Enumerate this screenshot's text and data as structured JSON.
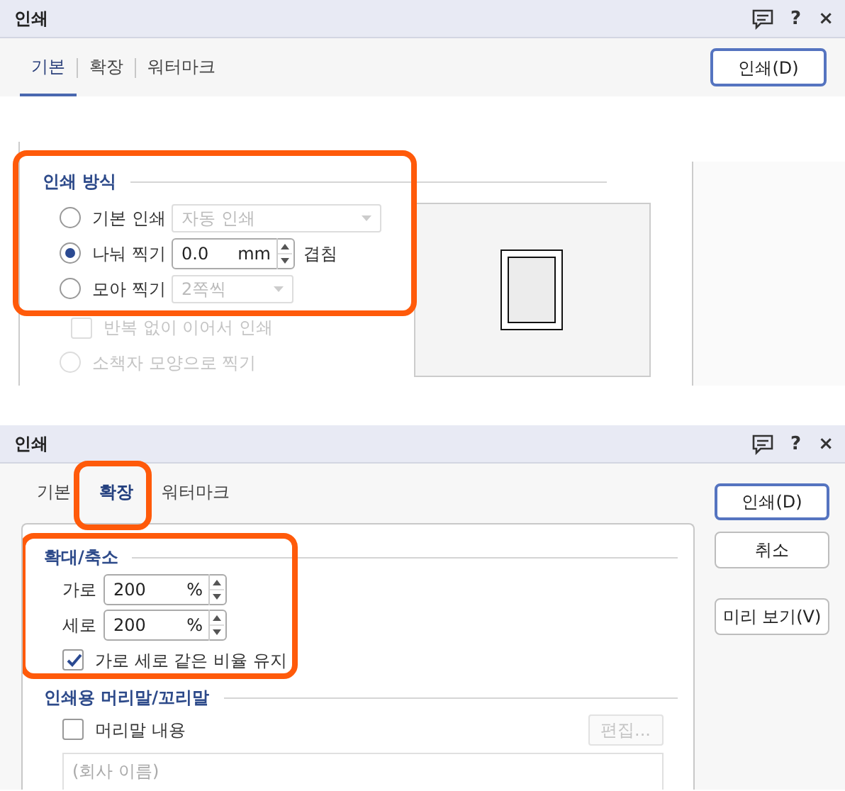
{
  "dialogs": [
    {
      "kind": "basic",
      "title": "인쇄",
      "title_buttons": [
        "?",
        "×"
      ],
      "tabs": [
        {
          "label": "기본",
          "selected": true,
          "highlighted": false
        },
        {
          "label": "확장",
          "selected": false,
          "highlighted": false
        },
        {
          "label": "워터마크",
          "selected": false,
          "highlighted": false
        }
      ],
      "button_groups": [
        [
          {
            "label": "인쇄(D)",
            "default": true
          }
        ]
      ],
      "section": {
        "title": "인쇄 방식",
        "highlighted": true,
        "options": [
          {
            "kind": "radio",
            "label": "기본 인쇄",
            "selected": false,
            "disabled": false,
            "control": {
              "kind": "dropdown",
              "value": "자동 인쇄",
              "disabled": true
            }
          },
          {
            "kind": "radio",
            "label": "나눠 찍기",
            "selected": true,
            "disabled": false,
            "control": {
              "kind": "spin",
              "value": "0.0",
              "unit": "mm",
              "suffix": "겹침"
            }
          },
          {
            "kind": "radio",
            "label": "모아 찍기",
            "selected": false,
            "disabled": false,
            "control": {
              "kind": "dropdown",
              "value": "2쪽씩",
              "disabled": true
            }
          },
          {
            "kind": "checkbox",
            "label": "반복 없이 이어서 인쇄",
            "checked": false,
            "disabled": true
          },
          {
            "kind": "radio",
            "label": "소책자 모양으로 찍기",
            "selected": false,
            "disabled": true
          }
        ]
      }
    },
    {
      "kind": "extended",
      "title": "인쇄",
      "title_buttons": [
        "?",
        "×"
      ],
      "tabs": [
        {
          "label": "기본",
          "selected": false,
          "highlighted": false
        },
        {
          "label": "확장",
          "selected": true,
          "highlighted": true
        },
        {
          "label": "워터마크",
          "selected": false,
          "highlighted": false
        }
      ],
      "button_groups": [
        [
          {
            "label": "인쇄(D)",
            "default": true
          },
          {
            "label": "취소",
            "default": false
          }
        ],
        [
          {
            "label": "미리 보기(V)",
            "default": false
          }
        ]
      ],
      "sections": [
        {
          "title": "확대/축소",
          "highlighted": true,
          "items": [
            {
              "kind": "spin",
              "label": "가로",
              "value": "200",
              "unit": "%"
            },
            {
              "kind": "spin",
              "label": "세로",
              "value": "200",
              "unit": "%"
            },
            {
              "kind": "checkbox",
              "label": "가로 세로 같은 비율 유지",
              "checked": true,
              "disabled": false
            }
          ]
        },
        {
          "title": "인쇄용 머리말/꼬리말",
          "highlighted": false,
          "items": [
            {
              "kind": "checkbox",
              "label": "머리말 내용",
              "checked": false,
              "disabled": false,
              "button": {
                "label": "편집...",
                "disabled": true
              }
            },
            {
              "kind": "textarea",
              "value": "(회사 이름)",
              "disabled": true
            }
          ]
        }
      ]
    }
  ]
}
